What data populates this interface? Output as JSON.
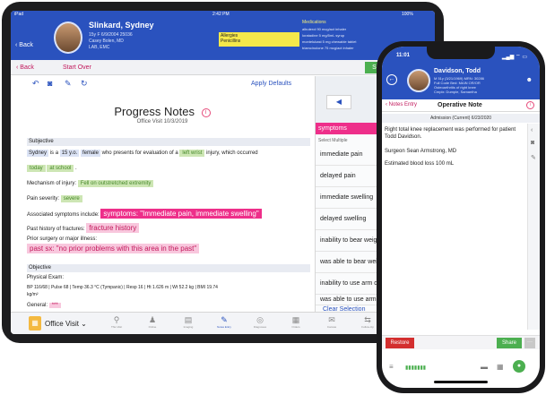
{
  "ipad": {
    "status": {
      "carrier": "iPad",
      "time": "2:42 PM",
      "battery": "100%"
    },
    "header": {
      "back_label": "Back",
      "patient_name": "Slinkard, Sydney",
      "demo_1": "15y F  6/9/2004  25036",
      "demo_2": "Casey Bolen, MD",
      "demo_3": "LAB, EMC",
      "allergies_title": "Allergies",
      "allergies_value": "Penicillins",
      "meds_title": "Medications",
      "meds": [
        "albuterol 90 mcg/act inhaler",
        "loratadine 5 mg/5mL syrup",
        "montelukast 5 mg chewable tablet",
        "triamcinolone 75 mcg/act inhaler"
      ]
    },
    "nav": {
      "back_label": "Back",
      "start_over": "Start Over",
      "sign_on": "Sign on"
    },
    "toolbar": {
      "apply_defaults": "Apply Defaults"
    },
    "document": {
      "title": "Progress Notes",
      "info_glyph": "i",
      "subtitle": "Office Visit 10/3/2019",
      "subjective_header": "Subjective",
      "line1": {
        "a": "Sydney",
        "b": "is a",
        "c": "15 y.o.",
        "d": "female",
        "e": "who presents for evaluation of a",
        "f": "left wrist",
        "g": "injury, which occurred"
      },
      "line2": {
        "a": "today",
        "b": "at school",
        "c": "."
      },
      "mechanism_label": "Mechanism of injury:",
      "mechanism_value": "Fell on outstretched extremity",
      "severity_label": "Pain severity:",
      "severity_value": "severe",
      "assoc_label": "Associated symptoms include:",
      "assoc_value": "symptoms: \"Immediate pain, immediate swelling\"",
      "fracture_label": "Past history of fractures:",
      "fracture_value": "fracture history",
      "prior_label": "Prior surgery or major illness:",
      "prior_value": "past sx: \"no prior problems with this area in the past\"",
      "objective_header": "Objective",
      "physical_label": "Physical Exam:",
      "vitals_1": "BP 116/68  |  Pulse 68  |  Temp 36.3 °C (Tympanic)  |  Resp 16  |  Ht 1.626 m  |  Wt 52.2 kg  |  BMI 19.74",
      "vitals_2": "kg/m²",
      "general_label": "General:",
      "general_value": "***"
    },
    "side_panel": {
      "arrow": "◀",
      "header": "symptoms",
      "select_multiple": "Select Multiple",
      "options": [
        "immediate pain",
        "delayed pain",
        "immediate swelling",
        "delayed swelling",
        "inability to bear weight",
        "was able to bear weight",
        "inability to use arm dire",
        "was able to use arm dire"
      ],
      "clear": "Clear Selection"
    },
    "bottom_bar": {
      "visit_label": "Office Visit",
      "tabs": [
        {
          "label": "This Visit",
          "icon": "pin-icon",
          "glyph": "⚲"
        },
        {
          "label": "Online",
          "icon": "people-icon",
          "glyph": "♟"
        },
        {
          "label": "Imaging",
          "icon": "image-icon",
          "glyph": "▤"
        },
        {
          "label": "Notes Entry",
          "icon": "notes-icon",
          "glyph": "✎"
        },
        {
          "label": "Diagnoses",
          "icon": "diagnoses-icon",
          "glyph": "◎"
        },
        {
          "label": "Orders",
          "icon": "orders-icon",
          "glyph": "▦"
        },
        {
          "label": "Canvas",
          "icon": "mail-icon",
          "glyph": "✉"
        },
        {
          "label": "Follow-Up",
          "icon": "followup-icon",
          "glyph": "⇆"
        },
        {
          "label": "Sign Visit",
          "icon": "sign-icon",
          "glyph": "☰"
        }
      ]
    }
  },
  "iphone": {
    "status": {
      "time": "11:01",
      "icons": "▂▄▆ ⌔ ▭"
    },
    "header": {
      "patient_name": "Davidson, Todd",
      "demo_1": "M 51y (3/21/1969)  MRN: 30286",
      "demo_2": "Full Code  Bed: MAIN OR/OR",
      "demo_3": "Osteoarthritis of right knee",
      "demo_4": "Cmplx: Dumple, Samantha"
    },
    "nav": {
      "back_label": "Notes Entry",
      "title": "Operative Note",
      "info_glyph": "i"
    },
    "admission": "Admission (Current) 6/23/2020",
    "note_lines": [
      "Right total knee replacement was performed for patient Todd Davidson.",
      "Surgeon Sean Armstrong, MD",
      "Estimated blood loss 100 mL"
    ],
    "actions": {
      "restore": "Restore",
      "share": "Share",
      "more": "···"
    }
  },
  "colors": {
    "header_blue": "#2a52be",
    "accent_pink": "#ee2f8a",
    "smart_green": "#cde6b4",
    "allergy_yellow": "#f5e84a"
  }
}
